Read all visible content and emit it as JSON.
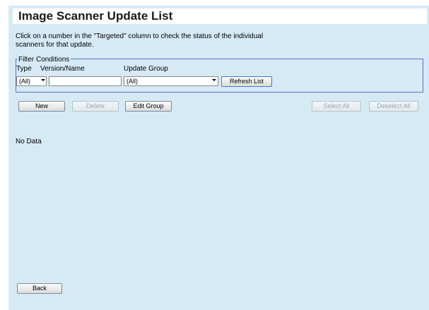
{
  "page": {
    "title": "Image Scanner Update List",
    "instructions": "Click on a number in the \"Targeted\" column to check the status of the individual scanners for that update."
  },
  "filter": {
    "legend": "Filter Conditions",
    "type_label": "Type",
    "type_value": "(All)",
    "version_label": "Version/Name",
    "version_value": "",
    "group_label": "Update Group",
    "group_value": "(All)",
    "refresh_label": "Refresh List"
  },
  "toolbar": {
    "new_label": "New",
    "delete_label": "Delete",
    "edit_group_label": "Edit Group",
    "select_all_label": "Select All",
    "deselect_all_label": "Deselect All"
  },
  "list": {
    "empty_text": "No Data"
  },
  "footer": {
    "back_label": "Back"
  },
  "colors": {
    "panel_bg": "#d6eaf6",
    "filter_border": "#5a6fd0",
    "accent": "#3a7bd5"
  },
  "icons": {
    "dropdown": "chevron-down-icon"
  }
}
